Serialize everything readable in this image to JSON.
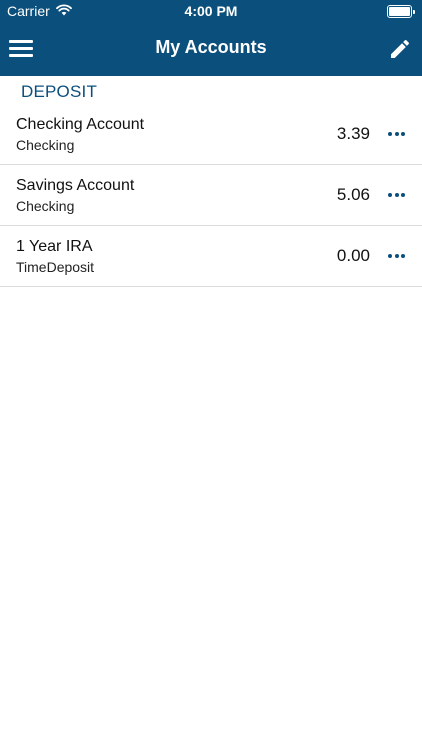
{
  "status_bar": {
    "carrier": "Carrier",
    "time": "4:00 PM",
    "battery_level": 1.0
  },
  "nav": {
    "title": "My Accounts",
    "left_icon": "hamburger-menu-icon",
    "right_icon": "pencil-edit-icon"
  },
  "section": {
    "header": "DEPOSIT"
  },
  "accounts": [
    {
      "name": "Checking Account",
      "type": "Checking",
      "balance": "3.39"
    },
    {
      "name": "Savings Account",
      "type": "Checking",
      "balance": "5.06"
    },
    {
      "name": "1 Year IRA",
      "type": "TimeDeposit",
      "balance": "0.00"
    }
  ],
  "colors": {
    "primary": "#0b4f7c",
    "divider": "#dcdcdc",
    "background": "#ffffff"
  }
}
